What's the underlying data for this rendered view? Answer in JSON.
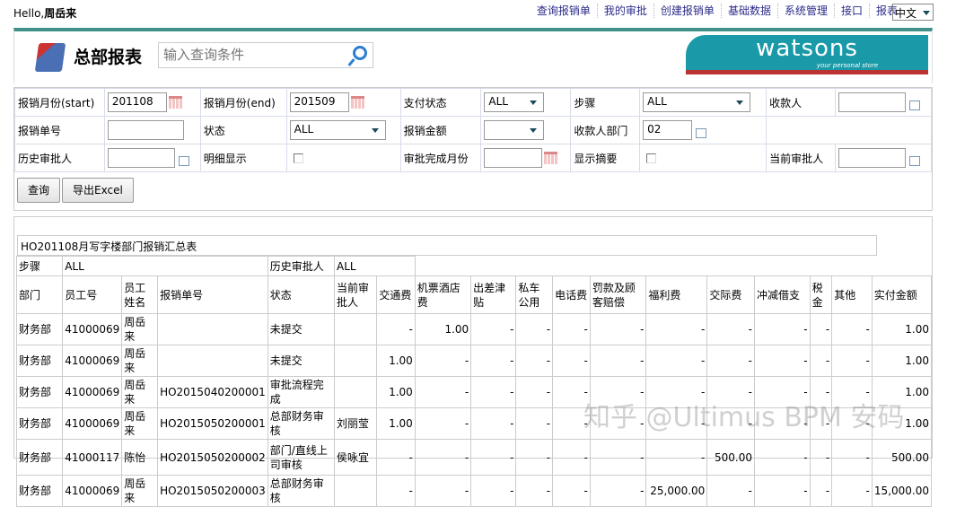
{
  "top": {
    "hello": "Hello,",
    "user": "周岳来",
    "nav": [
      "查询报销单",
      "我的审批",
      "创建报销单",
      "基础数据",
      "系统管理",
      "接口",
      "报表"
    ],
    "lang": "中文"
  },
  "header": {
    "title": "总部报表",
    "search_placeholder": "输入查询条件",
    "logo": "watsons",
    "logo_tag": "your personal store"
  },
  "form": {
    "start_label": "报销月份(start)",
    "start_value": "201108",
    "end_label": "报销月份(end)",
    "end_value": "201509",
    "pay_label": "支付状态",
    "pay_value": "ALL",
    "step_label": "步骤",
    "step_value": "ALL",
    "payee_label": "收款人",
    "payee_value": "",
    "no_label": "报销单号",
    "no_value": "",
    "status_label": "状态",
    "status_value": "ALL",
    "amount_label": "报销金额",
    "amount_value": "",
    "payee_dept_label": "收款人部门",
    "payee_dept_value": "02",
    "hist_label": "历史审批人",
    "hist_value": "",
    "detail_label": "明细显示",
    "done_label": "审批完成月份",
    "done_value": "",
    "summary_label": "显示摘要",
    "cur_label": "当前审批人",
    "cur_value": "",
    "query": "查询",
    "export": "导出Excel"
  },
  "report": {
    "title": "HO201108月写字楼部门报销汇总表",
    "step_label": "步骤",
    "step_value": "ALL",
    "hist_label": "历史审批人",
    "hist_value": "ALL",
    "columns": [
      "部门",
      "员工号",
      "员工姓名",
      "报销单号",
      "状态",
      "当前审批人",
      "交通费",
      "机票酒店费",
      "出差津贴",
      "私车公用",
      "电话费",
      "罚款及顾客赔偿",
      "福利费",
      "交际费",
      "冲减借支",
      "税金",
      "其他",
      "实付金额"
    ],
    "rows": [
      [
        "财务部",
        "41000069",
        "周岳来",
        "",
        "未提交",
        "",
        "-",
        "1.00",
        "-",
        "-",
        "-",
        "-",
        "-",
        "-",
        "-",
        "-",
        "-",
        "1.00"
      ],
      [
        "财务部",
        "41000069",
        "周岳来",
        "",
        "未提交",
        "",
        "1.00",
        "-",
        "-",
        "-",
        "-",
        "-",
        "-",
        "-",
        "-",
        "-",
        "-",
        "1.00"
      ],
      [
        "财务部",
        "41000069",
        "周岳来",
        "HO2015040200001",
        "审批流程完成",
        "",
        "1.00",
        "-",
        "-",
        "-",
        "-",
        "-",
        "-",
        "-",
        "-",
        "-",
        "-",
        "1.00"
      ],
      [
        "财务部",
        "41000069",
        "周岳来",
        "HO2015050200001",
        "总部财务审核",
        "刘丽莹",
        "1.00",
        "-",
        "-",
        "-",
        "-",
        "-",
        "-",
        "-",
        "-",
        "-",
        "-",
        "1.00"
      ],
      [
        "财务部",
        "41000117",
        "陈怡",
        "HO2015050200002",
        "部门/直线上司审核",
        "侯咏宜",
        "-",
        "-",
        "-",
        "-",
        "-",
        "-",
        "-",
        "500.00",
        "-",
        "-",
        "-",
        "500.00"
      ],
      [
        "财务部",
        "41000069",
        "周岳来",
        "HO2015050200003",
        "总部财务审核",
        "",
        "-",
        "-",
        "-",
        "-",
        "-",
        "-",
        "25,000.00",
        "-",
        "-",
        "-",
        "-",
        "15,000.00"
      ]
    ]
  },
  "watermark": "知乎 @Ultimus BPM 安码..."
}
